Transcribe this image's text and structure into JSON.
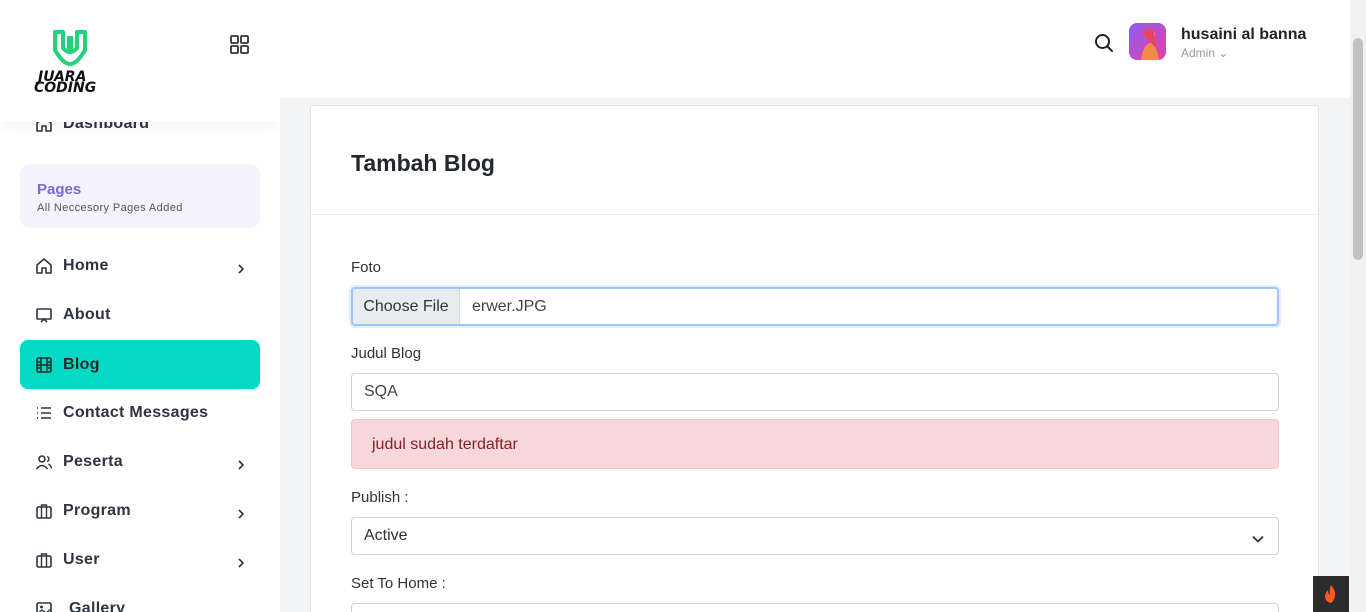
{
  "brand": {
    "line1": "JUARA",
    "line2": "CODING",
    "accent": "#22d17a"
  },
  "sidebar": {
    "active_color": "#03d9c5",
    "pages_box": {
      "title": "Pages",
      "subtitle": "All Neccesory Pages Added"
    },
    "items": [
      {
        "label": "Dashboard",
        "icon": "home-icon"
      },
      {
        "label": "Home",
        "icon": "home-icon",
        "has_submenu": true
      },
      {
        "label": "About",
        "icon": "monitor-icon"
      },
      {
        "label": "Blog",
        "icon": "film-icon",
        "active": true
      },
      {
        "label": "Contact Messages",
        "icon": "list-icon"
      },
      {
        "label": "Peserta",
        "icon": "users-icon",
        "has_submenu": true
      },
      {
        "label": "Program",
        "icon": "briefcase-icon",
        "has_submenu": true
      },
      {
        "label": "User",
        "icon": "briefcase-icon",
        "has_submenu": true
      },
      {
        "label": "Gallery",
        "icon": "image-icon"
      }
    ]
  },
  "header": {
    "user_name": "husaini al banna",
    "user_role": "Admin ⌄"
  },
  "form": {
    "title": "Tambah Blog",
    "foto_label": "Foto",
    "file_button": "Choose File",
    "file_name": "erwer.JPG",
    "judul_label": "Judul Blog",
    "judul_value": "SQA",
    "error_message": "judul sudah terdaftar",
    "publish_label": "Publish :",
    "publish_value": "Active",
    "set_home_label": "Set To Home :"
  }
}
